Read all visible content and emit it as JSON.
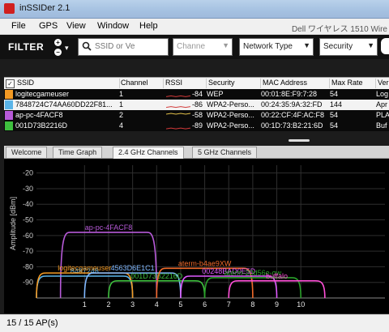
{
  "window": {
    "title": "inSSIDer 2.1"
  },
  "menu": {
    "items": [
      "File",
      "GPS",
      "View",
      "Window",
      "Help"
    ],
    "adapter": "Dell ワイヤレス 1510 Wire"
  },
  "filters": {
    "label": "FILTER",
    "plus": "+",
    "minus": "−",
    "ssid_placeholder": "SSID or Ve",
    "channel_placeholder": "Channe",
    "network_type": "Network Type",
    "security": "Security"
  },
  "table": {
    "columns": [
      "SSID",
      "Channel",
      "RSSI",
      "Security",
      "MAC Address",
      "Max Rate",
      "Ver"
    ],
    "rows": [
      {
        "ssid": "logitecgameuser",
        "channel": "1",
        "rssi": "-84",
        "security": "WEP",
        "mac": "00:01:8E:F9:7:28",
        "rate": "54",
        "vendor": "Log",
        "color": "#f39a24",
        "selected": false
      },
      {
        "ssid": "7848724C74AA60DD22F81...",
        "channel": "1",
        "rssi": "-86",
        "security": "WPA2-Perso...",
        "mac": "00:24:35:9A:32:FD",
        "rate": "144",
        "vendor": "Apr",
        "color": "#5ab4e8",
        "selected": true
      },
      {
        "ssid": "ap-pc-4FACF8",
        "channel": "2",
        "rssi": "-58",
        "security": "WPA2-Perso...",
        "mac": "00:22:CF:4F:AC:F8",
        "rate": "54",
        "vendor": "PLA",
        "color": "#b75ad8",
        "selected": false
      },
      {
        "ssid": "001D73B2216D",
        "channel": "4",
        "rssi": "-89",
        "security": "WPA2-Perso...",
        "mac": "00:1D:73:B2:21:6D",
        "rate": "54",
        "vendor": "Buf",
        "color": "#3ebf3e",
        "selected": false
      }
    ]
  },
  "tabs": [
    "Welcome",
    "Time Graph",
    "2.4 GHz Channels",
    "5 GHz Channels"
  ],
  "active_tab": "2.4 GHz Channels",
  "chart_data": {
    "type": "area",
    "ylabel": "Amplitude [dBm]",
    "x_ticks": [
      1,
      2,
      3,
      4,
      5,
      6,
      7,
      8,
      9,
      10
    ],
    "y_ticks": [
      -20,
      -30,
      -40,
      -50,
      -60,
      -70,
      -80,
      -90
    ],
    "ylim": [
      -100,
      -15
    ],
    "series": [
      {
        "name": "ap-pc-4FACF8",
        "center": 2,
        "rssi": -58,
        "color": "#b75ad8"
      },
      {
        "name": "8487248",
        "center": 1,
        "rssi": -86,
        "color": "#5ab4e8"
      },
      {
        "name": "logitecgameuser",
        "center": 1,
        "rssi": -84,
        "color": "#f39a24"
      },
      {
        "name": "4563D6E1C1",
        "center": 3,
        "rssi": -84,
        "color": "#7fb8ff"
      },
      {
        "name": "001D73B2216D",
        "center": 4,
        "rssi": -89,
        "color": "#3ebf3e"
      },
      {
        "name": "aterm-b4ae9XW",
        "center": 6,
        "rssi": -81,
        "color": "#f06a2a"
      },
      {
        "name": "00248BAD0E5D",
        "center": 7,
        "rssi": -86,
        "color": "#e05bff"
      },
      {
        "name": "aterm-20d56e-gw",
        "center": 8,
        "rssi": -87,
        "color": "#2aa02a"
      },
      {
        "name": "buffalo",
        "center": 9,
        "rssi": -89,
        "color": "#ff4fd8"
      }
    ]
  },
  "status": "15 / 15 AP(s)"
}
